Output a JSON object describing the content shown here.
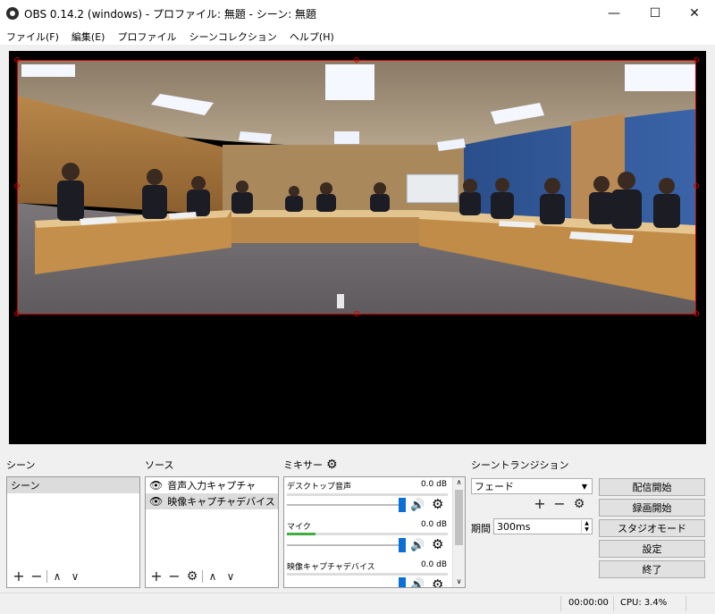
{
  "window": {
    "title": "OBS 0.14.2 (windows) - プロファイル: 無題 - シーン: 無題",
    "minimize": "—",
    "maximize": "☐",
    "close": "✕"
  },
  "menu": [
    "ファイル(F)",
    "編集(E)",
    "プロファイル",
    "シーンコレクション",
    "ヘルプ(H)"
  ],
  "scenes": {
    "title": "シーン",
    "items": [
      "シーン"
    ]
  },
  "sources": {
    "title": "ソース",
    "items": [
      "音声入力キャプチャ",
      "映像キャプチャデバイス"
    ]
  },
  "mixer": {
    "title": "ミキサー",
    "channels": [
      {
        "name": "デスクトップ音声",
        "db": "0.0 dB",
        "level": 0
      },
      {
        "name": "マイク",
        "db": "0.0 dB",
        "level": 0.18
      },
      {
        "name": "映像キャプチャデバイス",
        "db": "0.0 dB",
        "level": 0
      }
    ]
  },
  "transitions": {
    "title": "シーントランジション",
    "selected": "フェード",
    "duration_label": "期間",
    "duration_value": "300ms"
  },
  "controls": {
    "start_streaming": "配信開始",
    "start_recording": "録画開始",
    "studio_mode": "スタジオモード",
    "settings": "設定",
    "exit": "終了"
  },
  "status": {
    "time": "00:00:00",
    "cpu": "CPU: 3.4%"
  },
  "colors": {
    "selection_border": "#cc0000",
    "slider_thumb": "#0a6fd6",
    "meter_green": "#3fae3f"
  }
}
